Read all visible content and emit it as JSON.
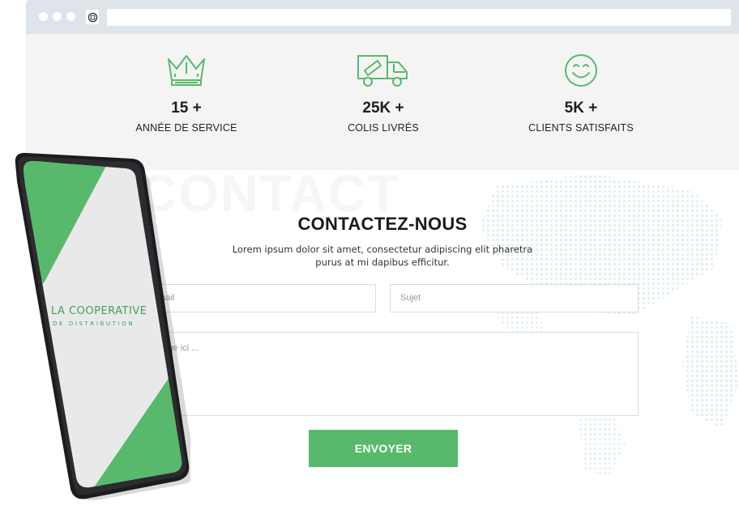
{
  "stats": [
    {
      "icon": "crown-icon",
      "value": "15 +",
      "label": "ANNÉE DE SERVICE"
    },
    {
      "icon": "delivery-truck-icon",
      "value": "25K +",
      "label": "COLIS LIVRÉS"
    },
    {
      "icon": "smiley-icon",
      "value": "5K +",
      "label": "CLIENTS SATISFAITS"
    }
  ],
  "contact": {
    "watermark": "CONTACT",
    "title": "CONTACTEZ-NOUS",
    "subtitle": "Lorem ipsum dolor sit amet, consectetur adipiscing elit pharetra purus at mi dapibus efficitur.",
    "email_placeholder": "Adresse mail",
    "email_visible": "sse mail",
    "subject_placeholder": "Sujet",
    "message_placeholder": "Votre message ici ...",
    "message_visible": "message ici ...",
    "submit_label": "ENVOYER"
  },
  "phone": {
    "brand_line1": "LA COOPERATIVE",
    "brand_line2": "DE DISTRIBUTION"
  },
  "colors": {
    "accent": "#58b96c",
    "chrome": "#dfe3ea",
    "stats_bg": "#f4f4f4"
  }
}
